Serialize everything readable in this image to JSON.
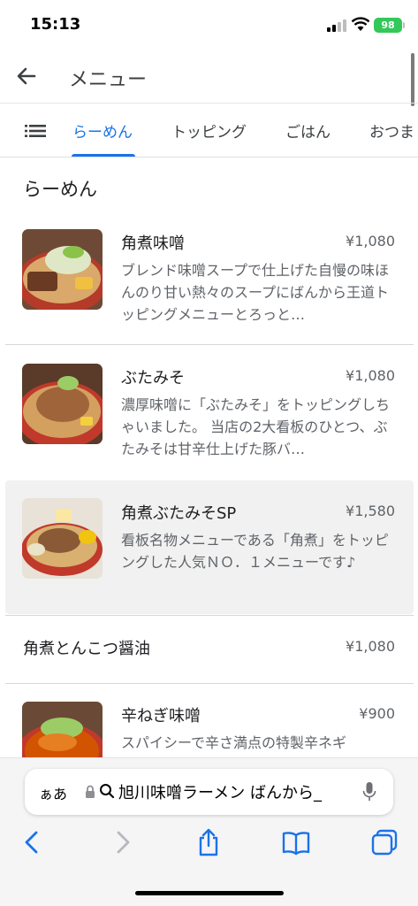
{
  "status_bar": {
    "time": "15:13",
    "battery": "98"
  },
  "header": {
    "title": "メニュー"
  },
  "tabs": [
    {
      "label": "らーめん",
      "active": true
    },
    {
      "label": "トッピング",
      "active": false
    },
    {
      "label": "ごはん",
      "active": false
    },
    {
      "label": "おつま",
      "active": false
    }
  ],
  "section": {
    "title": "らーめん"
  },
  "items": [
    {
      "name": "角煮味噌",
      "price": "¥1,080",
      "desc": "ブレンド味噌スープで仕上げた自慢の味ほんのり甘い熱々のスープにばんから王道トッピングメニューとろっと…"
    },
    {
      "name": "ぶたみそ",
      "price": "¥1,080",
      "desc": "濃厚味噌に「ぶたみそ」をトッピングしちゃいました。 当店の2大看板のひとつ、ぶたみそは甘辛仕上げた豚バ…"
    },
    {
      "name": "角煮ぶたみそSP",
      "price": "¥1,580",
      "desc": "看板名物メニューである「角煮」をトッピングした人気ＮＯ．１メニューです♪"
    },
    {
      "name": "角煮とんこつ醤油",
      "price": "¥1,080",
      "desc": ""
    },
    {
      "name": "辛ねぎ味噌",
      "price": "¥900",
      "desc": "スパイシーで辛さ満点の特製辛ネギ"
    }
  ],
  "browser": {
    "aa_label": "ぁあ",
    "address": "旭川味噌ラーメン ばんから_",
    "accent_color": "#1a73e8"
  },
  "icons": [
    "back-arrow-icon",
    "list-icon",
    "lock-icon",
    "search-icon",
    "mic-icon",
    "browser-back-icon",
    "browser-forward-icon",
    "share-icon",
    "bookmarks-icon",
    "tabs-icon"
  ]
}
